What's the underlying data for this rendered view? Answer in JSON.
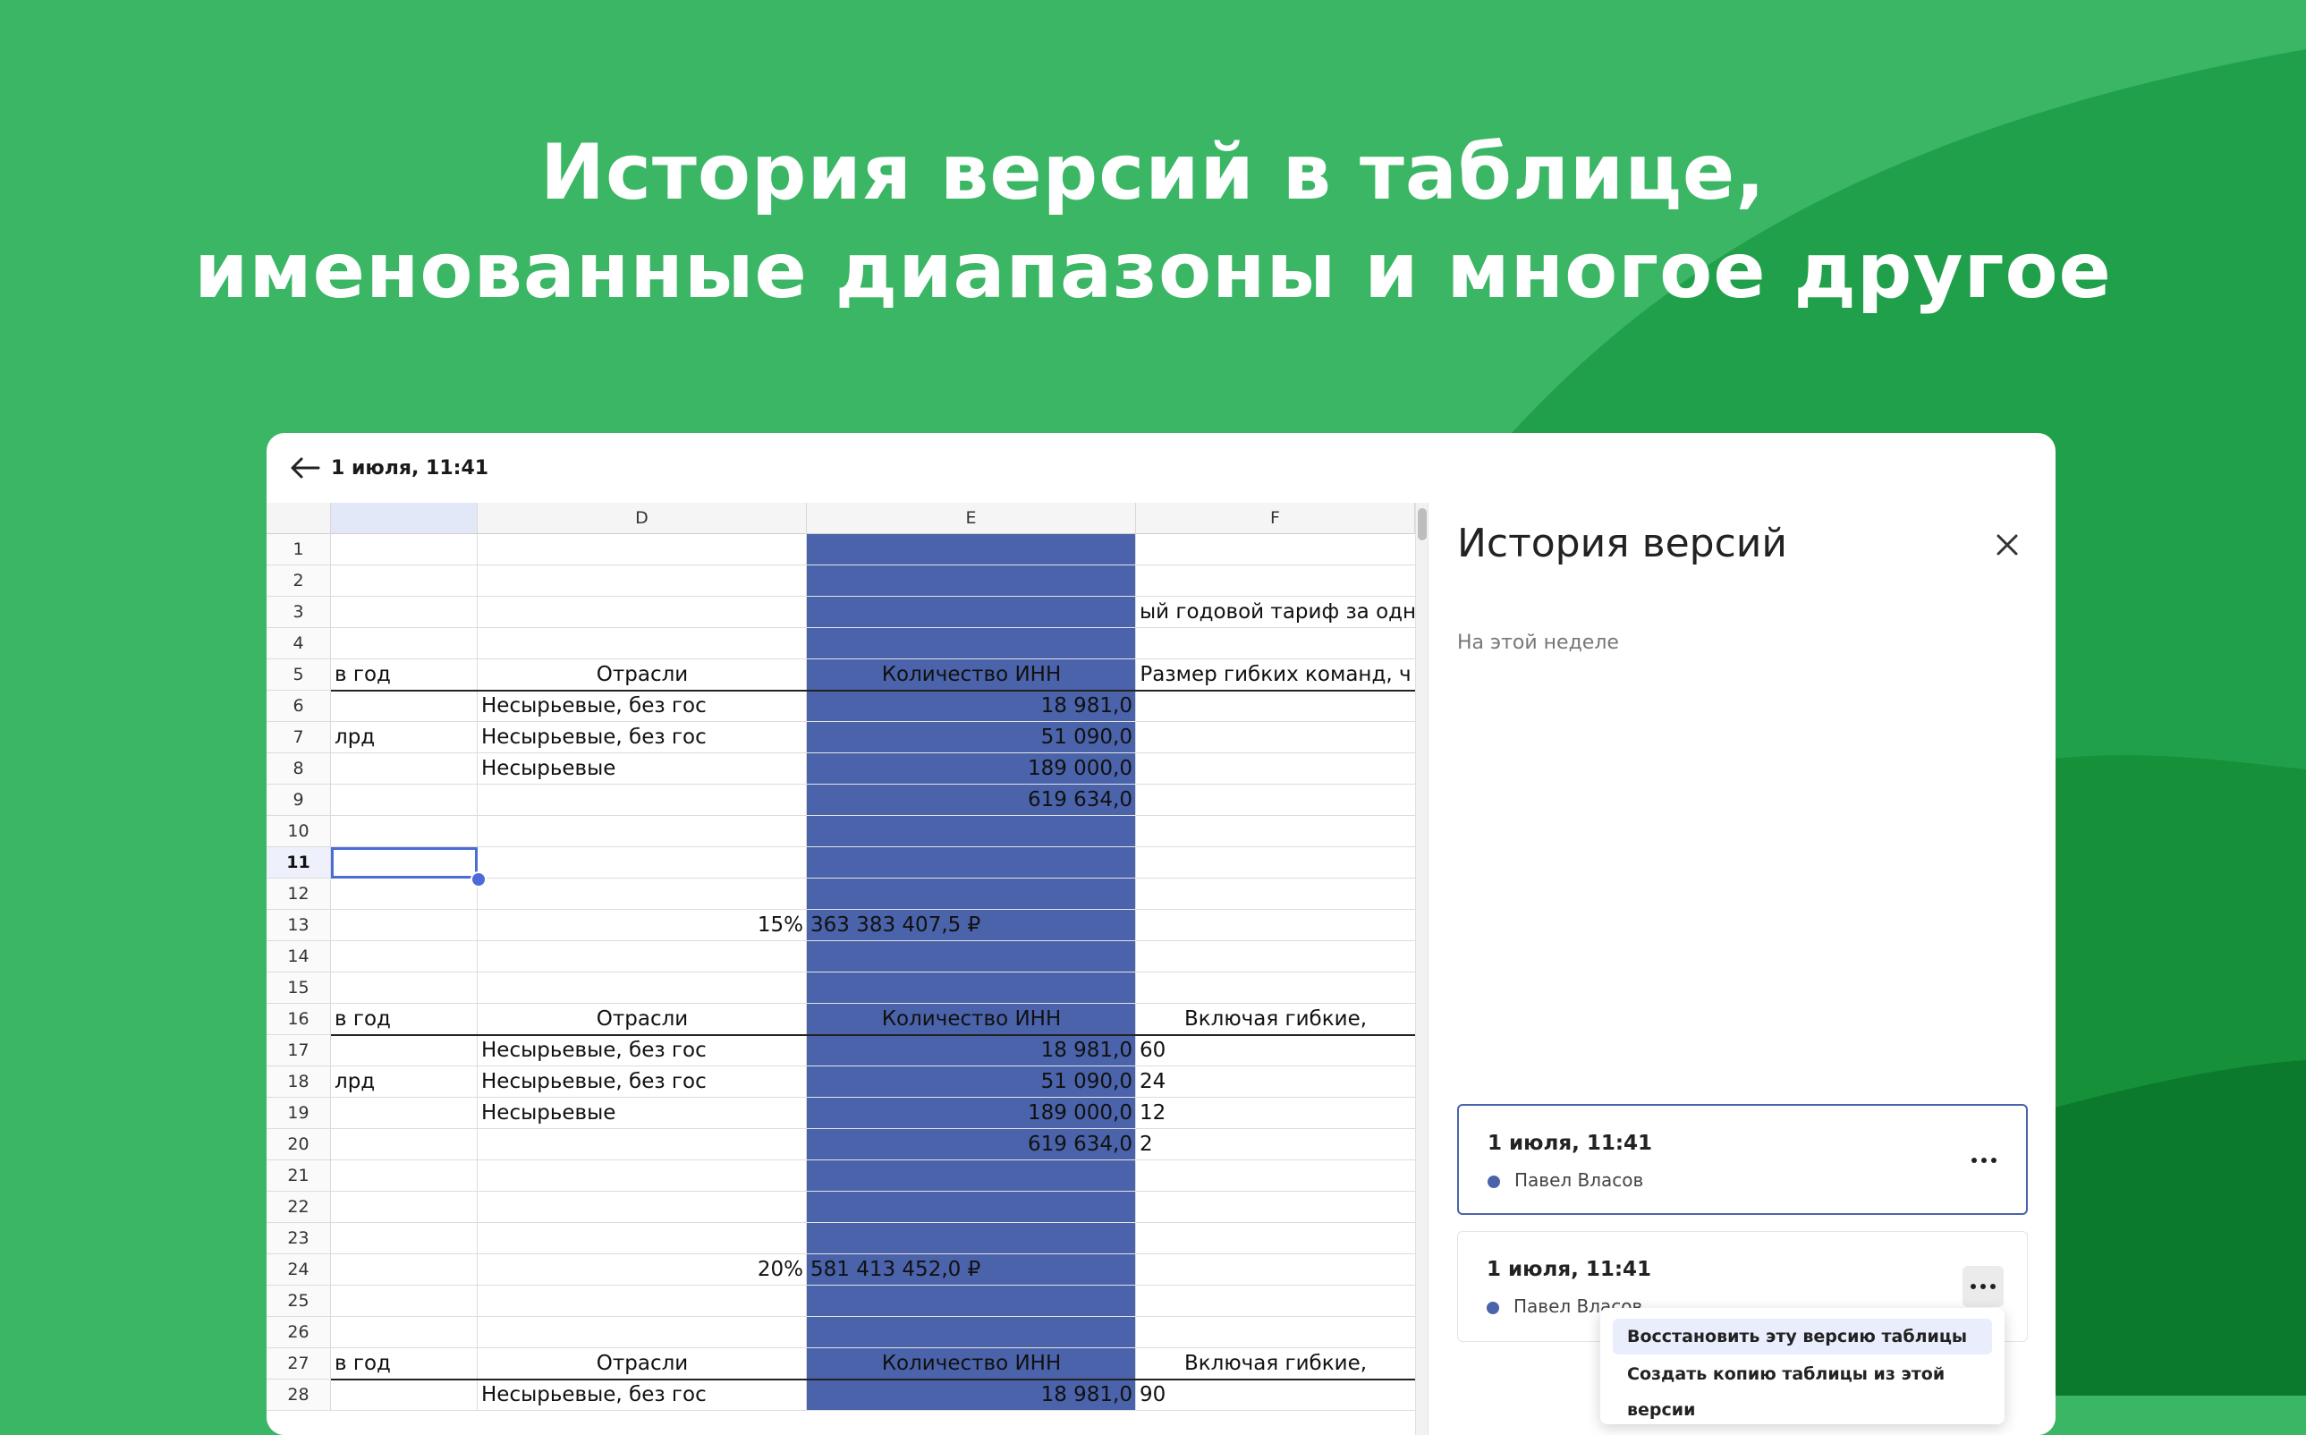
{
  "headline": {
    "line1": "История версий в таблице,",
    "line2": "именованные диапазоны и многое другое"
  },
  "colors": {
    "background": "#3bb665",
    "accent": "#4a63aa",
    "white": "#ffffff"
  },
  "topbar": {
    "back_icon": "arrow-left-icon",
    "title": "1 июля, 11:41"
  },
  "sheet": {
    "columns": [
      "",
      "D",
      "E",
      "F"
    ],
    "rows": [
      {
        "n": "1",
        "c": "",
        "d": "",
        "e": "",
        "f": ""
      },
      {
        "n": "2",
        "c": "",
        "d": "",
        "e": "",
        "f": ""
      },
      {
        "n": "3",
        "c": "",
        "d": "",
        "e": "",
        "f": "ый годовой тариф за одно м"
      },
      {
        "n": "4",
        "c": "",
        "d": "",
        "e": "",
        "f": ""
      },
      {
        "n": "5",
        "c": "в год",
        "d": "Отрасли",
        "e": "Количество ИНН",
        "f": "Размер гибких команд, ч"
      },
      {
        "n": "6",
        "c": "",
        "d": "Несырьевые, без гос",
        "e": "18 981,0",
        "f": ""
      },
      {
        "n": "7",
        "c": "лрд",
        "d": "Несырьевые, без гос",
        "e": "51 090,0",
        "f": ""
      },
      {
        "n": "8",
        "c": "",
        "d": "Несырьевые",
        "e": "189 000,0",
        "f": ""
      },
      {
        "n": "9",
        "c": "",
        "d": "",
        "e": "619 634,0",
        "f": ""
      },
      {
        "n": "10",
        "c": "",
        "d": "",
        "e": "",
        "f": ""
      },
      {
        "n": "11",
        "c": "",
        "d": "",
        "e": "",
        "f": ""
      },
      {
        "n": "12",
        "c": "",
        "d": "",
        "e": "",
        "f": ""
      },
      {
        "n": "13",
        "c": "",
        "d": "15%",
        "e": "363 383 407,5 ₽",
        "f": ""
      },
      {
        "n": "14",
        "c": "",
        "d": "",
        "e": "",
        "f": ""
      },
      {
        "n": "15",
        "c": "",
        "d": "",
        "e": "",
        "f": ""
      },
      {
        "n": "16",
        "c": "в год",
        "d": "Отрасли",
        "e": "Количество ИНН",
        "f": "Включая гибкие,"
      },
      {
        "n": "17",
        "c": "",
        "d": "Несырьевые, без гос",
        "e": "18 981,0",
        "f": "60"
      },
      {
        "n": "18",
        "c": "лрд",
        "d": "Несырьевые, без гос",
        "e": "51 090,0",
        "f": "24"
      },
      {
        "n": "19",
        "c": "",
        "d": "Несырьевые",
        "e": "189 000,0",
        "f": "12"
      },
      {
        "n": "20",
        "c": "",
        "d": "",
        "e": "619 634,0",
        "f": "2"
      },
      {
        "n": "21",
        "c": "",
        "d": "",
        "e": "",
        "f": ""
      },
      {
        "n": "22",
        "c": "",
        "d": "",
        "e": "",
        "f": ""
      },
      {
        "n": "23",
        "c": "",
        "d": "",
        "e": "",
        "f": ""
      },
      {
        "n": "24",
        "c": "",
        "d": "20%",
        "e": "581 413 452,0 ₽",
        "f": ""
      },
      {
        "n": "25",
        "c": "",
        "d": "",
        "e": "",
        "f": ""
      },
      {
        "n": "26",
        "c": "",
        "d": "",
        "e": "",
        "f": ""
      },
      {
        "n": "27",
        "c": "в год",
        "d": "Отрасли",
        "e": "Количество ИНН",
        "f": "Включая гибкие,"
      },
      {
        "n": "28",
        "c": "",
        "d": "Несырьевые, без гос",
        "e": "18 981,0",
        "f": "90"
      }
    ]
  },
  "panel": {
    "title": "История версий",
    "close_icon": "close-icon",
    "section": "На этой неделе",
    "versions": [
      {
        "time": "1 июля, 11:41",
        "author": "Павел Власов"
      },
      {
        "time": "1 июля, 11:41",
        "author": "Павел Власов"
      }
    ],
    "more_icon": "more-horizontal-icon",
    "menu": {
      "restore": "Восстановить эту версию таблицы",
      "copy": "Создать копию таблицы из этой версии"
    }
  }
}
